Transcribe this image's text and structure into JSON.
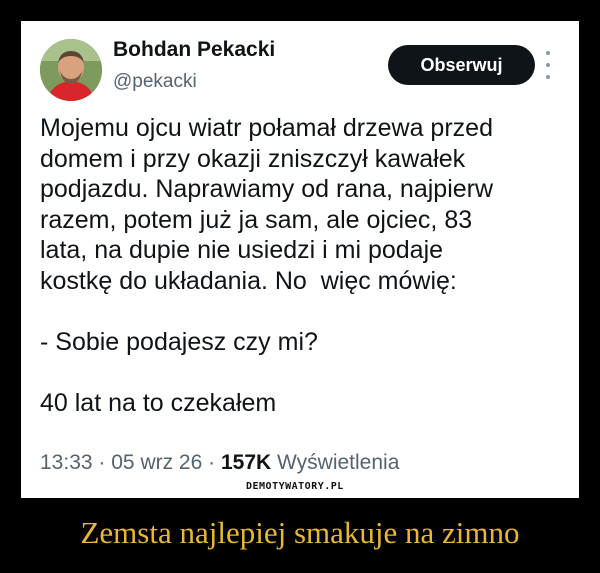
{
  "tweet": {
    "author_name": "Bohdan Pekacki",
    "author_handle": "@pekacki",
    "follow_label": "Obserwuj",
    "text": "Mojemu ojcu wiatr połamał drzewa przed\ndomem i przy okazji zniszczył kawałek\npodjazdu. Naprawiamy od rana, najpierw\nrazem, potem już ja sam, ale ojciec, 83\nlata, na dupie nie usiedzi i mi podaje\nkostkę do układania. No  więc mówię:\n\n- Sobie podajesz czy mi?\n\n40 lat na to czekałem",
    "time": "13:33",
    "separator": "·",
    "date": "05 wrz 26",
    "views_count": "157K",
    "views_label": "Wyświetlenia"
  },
  "watermark": "DEMOTYWATORY.PL",
  "caption": "Zemsta najlepiej smakuje na zimno",
  "colors": {
    "background": "#000000",
    "card": "#ffffff",
    "follow_button": "#0f1419",
    "caption": "#e9b830",
    "secondary_text": "#536471"
  }
}
